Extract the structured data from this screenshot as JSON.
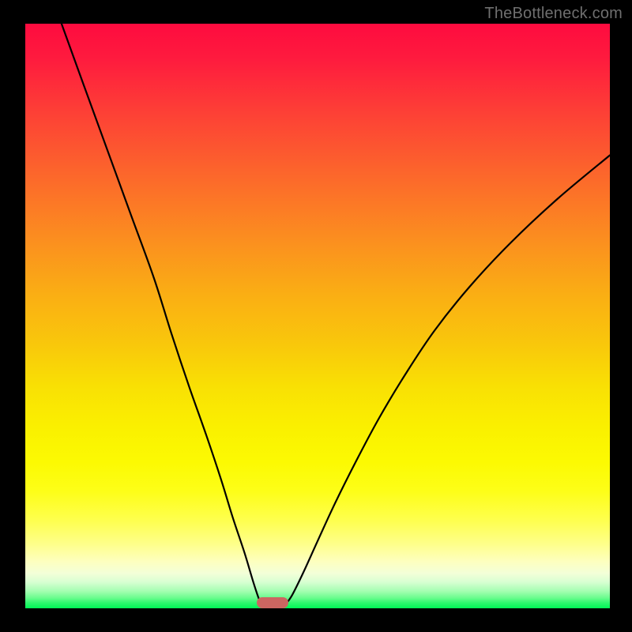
{
  "watermark": "TheBottleneck.com",
  "colors": {
    "frame": "#000000",
    "curve": "#000000",
    "marker": "#cc6661",
    "gradient_top": "#fe0b3f",
    "gradient_mid": "#f9e004",
    "gradient_bottom": "#00f756"
  },
  "chart_data": {
    "type": "line",
    "title": "",
    "xlabel": "",
    "ylabel": "",
    "x_range": [
      0,
      100
    ],
    "y_range": [
      0,
      100
    ],
    "note": "Axes are unlabeled; values are percent of plot width/height read from pixel positions. Two monotone curves descend from the top edge to a common minimum near x≈42, y≈0, where a small rounded marker sits at the bottom.",
    "series": [
      {
        "name": "left-curve",
        "x": [
          6.2,
          10,
          14,
          18,
          22,
          25,
          28,
          31,
          33.5,
          35.5,
          37.5,
          39,
          40,
          40.5
        ],
        "y": [
          100,
          89.5,
          78.5,
          67.5,
          56.5,
          47,
          38,
          29.5,
          22,
          15.5,
          9.5,
          4.5,
          1.5,
          0.5
        ]
      },
      {
        "name": "right-curve",
        "x": [
          44.3,
          45.5,
          47.5,
          50,
          53,
          56.5,
          60.5,
          65,
          70,
          76,
          83,
          91,
          100
        ],
        "y": [
          0.5,
          2,
          6,
          11.5,
          18,
          25,
          32.5,
          40,
          47.5,
          55,
          62.5,
          70,
          77.5
        ]
      }
    ],
    "marker": {
      "x": 42.3,
      "y": 0,
      "w_pct": 5.4,
      "h_pct": 1.9
    }
  }
}
